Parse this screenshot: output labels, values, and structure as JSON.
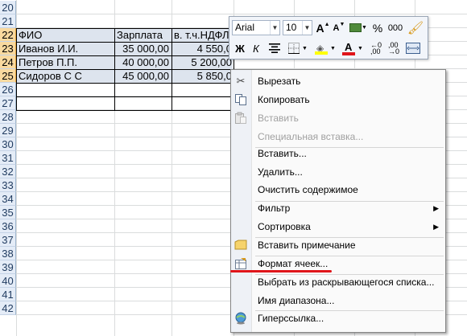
{
  "row_headers": [
    "20",
    "21",
    "22",
    "23",
    "24",
    "25",
    "26",
    "27",
    "28",
    "29",
    "30",
    "31",
    "32",
    "33",
    "34",
    "35",
    "36",
    "37",
    "38",
    "39",
    "40",
    "41",
    "42"
  ],
  "table": {
    "headers": [
      "ФИО",
      "Зарплата",
      "в. т.ч.НДФЛ"
    ],
    "rows": [
      [
        "Иванов И.И.",
        "35 000,00",
        "4 550,0"
      ],
      [
        "Петров П.П.",
        "40 000,00",
        "5 200,00"
      ],
      [
        "Сидоров С С",
        "45 000,00",
        "5 850,0"
      ]
    ]
  },
  "mini_toolbar": {
    "font_name": "Arial",
    "font_size": "10",
    "grow_font": "A",
    "shrink_font": "A",
    "bold": "Ж",
    "italic": "К",
    "percent": "%",
    "thousands": "000",
    "font_color_letter": "A"
  },
  "context_menu": {
    "items": [
      {
        "label": "Вырезать",
        "icon": "scissors-icon",
        "disabled": false,
        "submenu": false
      },
      {
        "label": "Копировать",
        "icon": "copy-icon",
        "disabled": false,
        "submenu": false
      },
      {
        "label": "Вставить",
        "icon": "paste-icon",
        "disabled": true,
        "submenu": false
      },
      {
        "label": "Специальная вставка...",
        "icon": "",
        "disabled": true,
        "submenu": false
      },
      {
        "label": "Вставить...",
        "icon": "",
        "disabled": false,
        "submenu": false
      },
      {
        "label": "Удалить...",
        "icon": "",
        "disabled": false,
        "submenu": false
      },
      {
        "label": "Очистить содержимое",
        "icon": "",
        "disabled": false,
        "submenu": false
      },
      {
        "label": "Фильтр",
        "icon": "",
        "disabled": false,
        "submenu": true
      },
      {
        "label": "Сортировка",
        "icon": "",
        "disabled": false,
        "submenu": true
      },
      {
        "label": "Вставить примечание",
        "icon": "comment-icon",
        "disabled": false,
        "submenu": false
      },
      {
        "label": "Формат ячеек...",
        "icon": "format-cells-icon",
        "disabled": false,
        "submenu": false
      },
      {
        "label": "Выбрать из раскрывающегося списка...",
        "icon": "",
        "disabled": false,
        "submenu": false
      },
      {
        "label": "Имя диапазона...",
        "icon": "",
        "disabled": false,
        "submenu": false
      },
      {
        "label": "Гиперссылка...",
        "icon": "hyperlink-icon",
        "disabled": false,
        "submenu": false
      }
    ]
  },
  "colors": {
    "header_bg": "#e4ecf7",
    "selected_header_bg": "#f9d99f",
    "selection_fill": "#dde4ee",
    "highlight_red": "#e0151a",
    "font_color_bar": "#e0151a",
    "fill_color_bar": "#ffff00"
  }
}
